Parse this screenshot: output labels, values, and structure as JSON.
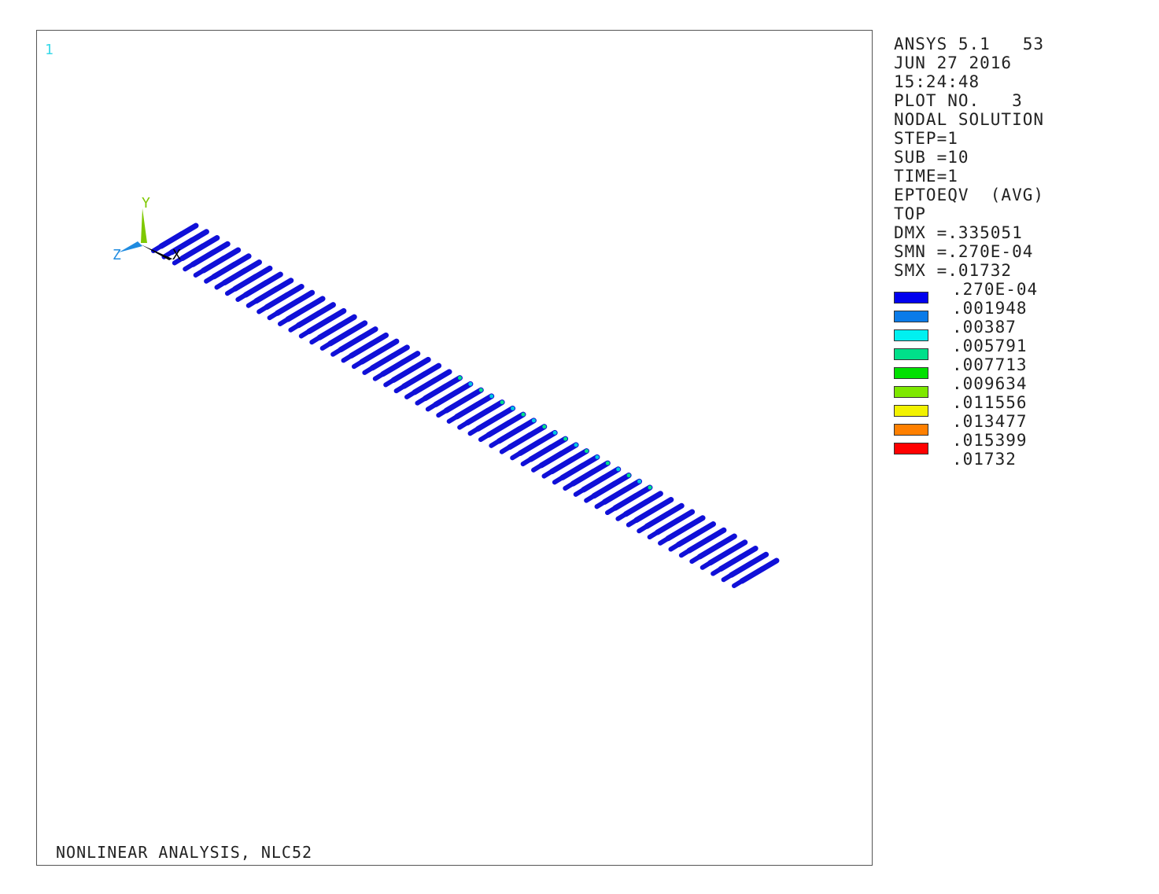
{
  "window": {
    "number": "1",
    "footer_title": "NONLINEAR ANALYSIS, NLC52"
  },
  "triad": {
    "x_label": "X",
    "y_label": "Y",
    "z_label": "Z",
    "x_color": "#000000",
    "y_color": "#7ec800",
    "z_color": "#1f8be0"
  },
  "info": [
    "ANSYS 5.1   53",
    "JUN 27 2016",
    "15:24:48",
    "PLOT NO.   3",
    "NODAL SOLUTION",
    "STEP=1",
    "SUB =10",
    "TIME=1",
    "EPTOEQV  (AVG)",
    "TOP",
    "DMX =.335051",
    "SMN =.270E-04",
    "SMX =.01732"
  ],
  "legend": {
    "values": [
      ".270E-04",
      ".001948",
      ".00387",
      ".005791",
      ".007713",
      ".009634",
      ".011556",
      ".013477",
      ".015399",
      ".01732"
    ],
    "colors": [
      "#0000ee",
      "#0b7be8",
      "#00f0f0",
      "#00e08a",
      "#00e000",
      "#7ee800",
      "#f2f200",
      "#ff8000",
      "#ff0000"
    ]
  },
  "model": {
    "element_color": "#1010d8",
    "element_count": 56
  }
}
